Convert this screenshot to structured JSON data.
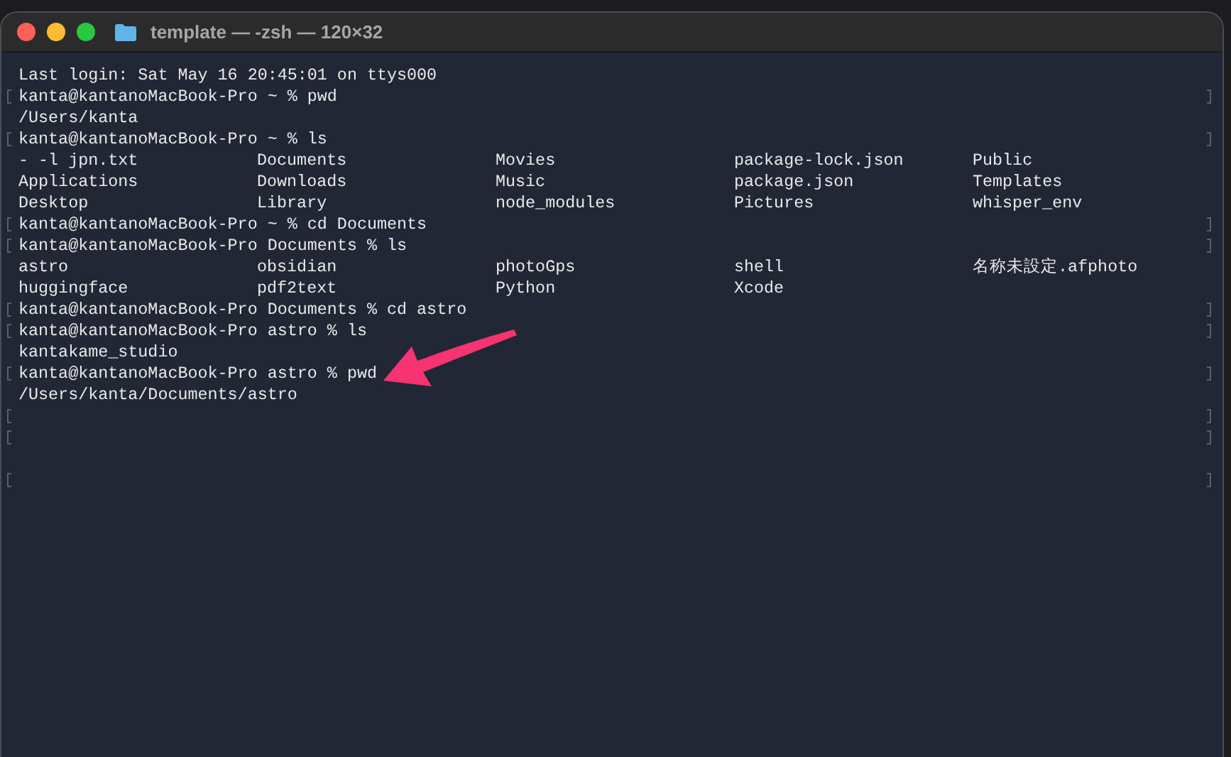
{
  "window": {
    "title": "template — -zsh — 120×32"
  },
  "lines": [
    {
      "kind": "text",
      "text": "Last login: Sat May 16 20:45:01 on ttys000",
      "marked": false
    },
    {
      "kind": "text",
      "text": "kanta@kantanoMacBook-Pro ~ % pwd",
      "marked": true
    },
    {
      "kind": "text",
      "text": "/Users/kanta",
      "marked": false
    },
    {
      "kind": "text",
      "text": "kanta@kantanoMacBook-Pro ~ % ls",
      "marked": true
    },
    {
      "kind": "columns",
      "cells": [
        "- -l jpn.txt",
        "Documents",
        "Movies",
        "package-lock.json",
        "Public"
      ],
      "marked": false
    },
    {
      "kind": "columns",
      "cells": [
        "Applications",
        "Downloads",
        "Music",
        "package.json",
        "Templates"
      ],
      "marked": false
    },
    {
      "kind": "columns",
      "cells": [
        "Desktop",
        "Library",
        "node_modules",
        "Pictures",
        "whisper_env"
      ],
      "marked": false
    },
    {
      "kind": "text",
      "text": "kanta@kantanoMacBook-Pro ~ % cd Documents",
      "marked": true
    },
    {
      "kind": "text",
      "text": "kanta@kantanoMacBook-Pro Documents % ls",
      "marked": true
    },
    {
      "kind": "columns",
      "cells": [
        "astro",
        "obsidian",
        "photoGps",
        "shell",
        "名称未設定.afphoto"
      ],
      "marked": false
    },
    {
      "kind": "columns",
      "cells": [
        "huggingface",
        "pdf2text",
        "Python",
        "Xcode"
      ],
      "marked": false
    },
    {
      "kind": "text",
      "text": "kanta@kantanoMacBook-Pro Documents % cd astro",
      "marked": true
    },
    {
      "kind": "text",
      "text": "kanta@kantanoMacBook-Pro astro % ls",
      "marked": true
    },
    {
      "kind": "text",
      "text": "kantakame_studio",
      "marked": false
    },
    {
      "kind": "text",
      "text": "kanta@kantanoMacBook-Pro astro % pwd",
      "marked": true
    },
    {
      "kind": "text",
      "text": "/Users/kanta/Documents/astro",
      "marked": false
    },
    {
      "kind": "empty",
      "marked": true
    },
    {
      "kind": "empty",
      "marked": true
    },
    {
      "kind": "empty",
      "marked": false
    },
    {
      "kind": "empty",
      "marked": true
    }
  ]
}
